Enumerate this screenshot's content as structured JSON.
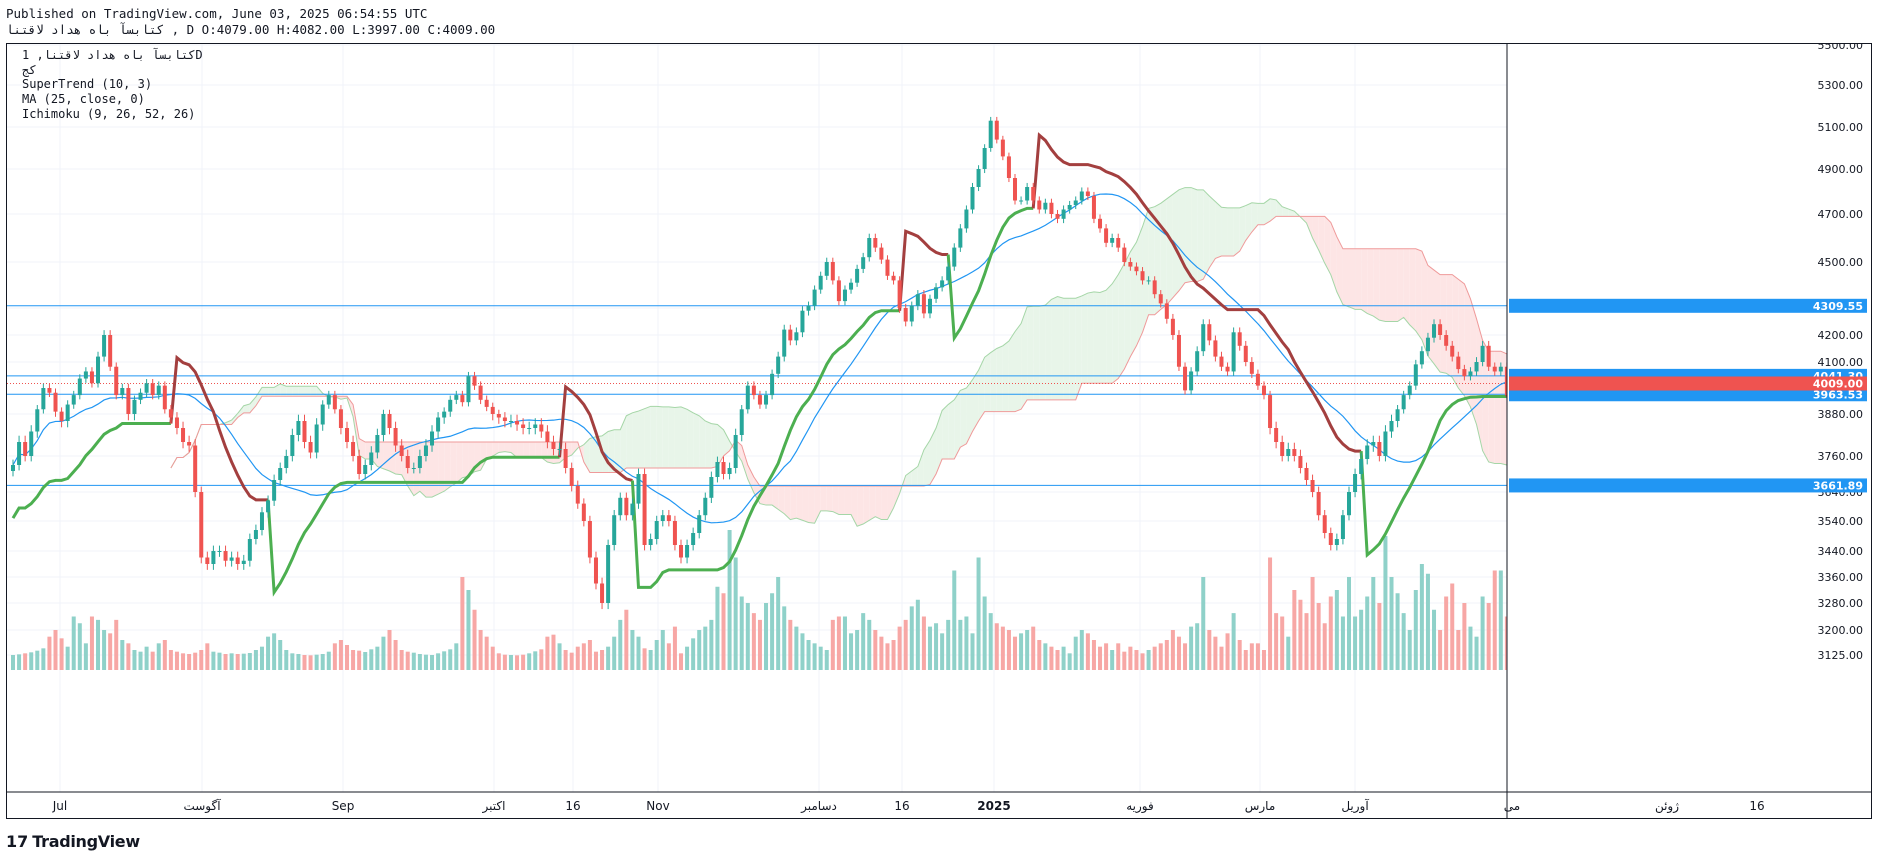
{
  "header": {
    "published": "Published on TradingView.com, June 03, 2025 06:54:55 UTC",
    "ohlc": "كتابسآ باه هداد لاقتنا , D O:4079.00 H:4082.00 L:3997.00 C:4009.00"
  },
  "legend": {
    "symbol": "كتابسآ باه هداد لاقتنا, 1D",
    "exchange": "كج",
    "supertrend": "SuperTrend (10, 3)",
    "ma": "MA (25, close, 0)",
    "ichimoku": "Ichimoku (9, 26, 52, 26)"
  },
  "footer": {
    "logo_mark": "17",
    "logo_text": "TradingView"
  },
  "colors": {
    "up": "#26a69a",
    "down": "#ef5350",
    "supertrend_up": "#4caf50",
    "supertrend_down": "#a33f3f",
    "ma": "#2196f3",
    "cloud_bull": "#e8f5e9",
    "cloud_bear": "#fde5e5",
    "hline": "#2196f3",
    "last_price": "#ef5350"
  },
  "chart_data": {
    "type": "candlestick",
    "y_axis": {
      "range": [
        3080,
        5500
      ],
      "ticks": [
        "5500.00",
        "5300.00",
        "5100.00",
        "4900.00",
        "4700.00",
        "4500.00",
        "4300.00",
        "4200.00",
        "4100.00",
        "3880.00",
        "3760.00",
        "3640.00",
        "3540.00",
        "3440.00",
        "3360.00",
        "3280.00",
        "3200.00",
        "3125.00"
      ]
    },
    "x_axis": {
      "labels": [
        "Jul",
        "آگوست",
        "Sep",
        "اکتبر",
        "16",
        "Nov",
        "دسامبر",
        "16",
        "2025",
        "فوریه",
        "مارس",
        "آوریل",
        "می",
        "ژوئن",
        "16"
      ]
    },
    "horizontal_lines": [
      {
        "value": 4309.55,
        "label": "4309.55"
      },
      {
        "value": 4041.3,
        "label": "4041.30"
      },
      {
        "value": 3963.53,
        "label": "3963.53"
      },
      {
        "value": 3661.89,
        "label": "3661.89"
      }
    ],
    "last_price": {
      "value": 4009.0,
      "label": "4009.00"
    },
    "last_candle": {
      "open": 4079.0,
      "high": 4082.0,
      "low": 3997.0,
      "close": 4009.0
    },
    "closes": [
      3730,
      3800,
      3760,
      3830,
      3900,
      3990,
      3970,
      3890,
      3860,
      3920,
      3960,
      4030,
      4060,
      4010,
      4120,
      4200,
      4080,
      3960,
      3990,
      3880,
      3940,
      3970,
      4010,
      3960,
      4000,
      3900,
      3870,
      3840,
      3800,
      3790,
      3640,
      3420,
      3400,
      3440,
      3440,
      3410,
      3420,
      3400,
      3410,
      3480,
      3510,
      3570,
      3610,
      3680,
      3720,
      3760,
      3820,
      3860,
      3800,
      3770,
      3850,
      3920,
      3960,
      3900,
      3840,
      3800,
      3760,
      3700,
      3730,
      3770,
      3820,
      3880,
      3840,
      3790,
      3760,
      3720,
      3720,
      3760,
      3790,
      3830,
      3870,
      3890,
      3940,
      3960,
      3930,
      4040,
      4000,
      3940,
      3910,
      3880,
      3870,
      3860,
      3860,
      3850,
      3840,
      3840,
      3850,
      3830,
      3800,
      3780,
      3780,
      3720,
      3660,
      3600,
      3540,
      3420,
      3340,
      3280,
      3460,
      3560,
      3620,
      3560,
      3600,
      3700,
      3460,
      3480,
      3540,
      3560,
      3540,
      3460,
      3420,
      3460,
      3500,
      3560,
      3620,
      3690,
      3740,
      3700,
      3720,
      3820,
      3900,
      4000,
      3960,
      3920,
      3960,
      4050,
      4120,
      4220,
      4180,
      4210,
      4290,
      4310,
      4380,
      4440,
      4500,
      4420,
      4330,
      4380,
      4410,
      4470,
      4520,
      4600,
      4560,
      4510,
      4440,
      4420,
      4300,
      4250,
      4310,
      4360,
      4280,
      4340,
      4390,
      4420,
      4480,
      4560,
      4640,
      4720,
      4820,
      4900,
      5000,
      5130,
      5040,
      4960,
      4860,
      4760,
      4760,
      4820,
      4760,
      4720,
      4750,
      4700,
      4680,
      4720,
      4740,
      4760,
      4800,
      4780,
      4680,
      4640,
      4580,
      4600,
      4560,
      4500,
      4480,
      4460,
      4420,
      4420,
      4360,
      4320,
      4260,
      4200,
      4080,
      3980,
      4060,
      4140,
      4240,
      4180,
      4120,
      4080,
      4060,
      4210,
      4160,
      4100,
      4050,
      4000,
      3960,
      3840,
      3800,
      3760,
      3780,
      3760,
      3720,
      3680,
      3640,
      3560,
      3500,
      3460,
      3480,
      3560,
      3640,
      3700,
      3750,
      3790,
      3800,
      3760,
      3830,
      3860,
      3900,
      3960,
      4000,
      4090,
      4140,
      4190,
      4240,
      4200,
      4160,
      4120,
      4070,
      4040,
      4060,
      4100,
      4160,
      4080,
      4060,
      4080,
      3960,
      3940,
      3920,
      3900,
      3960,
      4000,
      4060,
      4040,
      4100,
      4200,
      4300,
      4400,
      4460,
      4420,
      4340,
      4300,
      4160,
      4100,
      4060,
      4000,
      3960,
      3900,
      3840,
      3840,
      3860,
      3820,
      3860,
      3880,
      3960,
      4009
    ],
    "volumes": [
      3125,
      3127,
      3130,
      3133,
      3138,
      3145,
      3180,
      3200,
      3175,
      3150,
      3240,
      3220,
      3160,
      3240,
      3230,
      3200,
      3190,
      3230,
      3170,
      3160,
      3140,
      3135,
      3150,
      3135,
      3160,
      3170,
      3140,
      3135,
      3130,
      3128,
      3132,
      3140,
      3160,
      3135,
      3132,
      3128,
      3130,
      3128,
      3129,
      3131,
      3140,
      3150,
      3180,
      3190,
      3170,
      3140,
      3130,
      3128,
      3125,
      3124,
      3126,
      3128,
      3135,
      3160,
      3170,
      3155,
      3140,
      3138,
      3134,
      3142,
      3150,
      3180,
      3200,
      3170,
      3140,
      3135,
      3132,
      3128,
      3126,
      3125,
      3130,
      3136,
      3142,
      3160,
      3360,
      3320,
      3260,
      3200,
      3180,
      3150,
      3130,
      3126,
      3125,
      3124,
      3126,
      3130,
      3136,
      3142,
      3180,
      3186,
      3160,
      3140,
      3132,
      3150,
      3160,
      3170,
      3135,
      3140,
      3150,
      3180,
      3230,
      3260,
      3200,
      3180,
      3145,
      3140,
      3170,
      3200,
      3160,
      3210,
      3130,
      3150,
      3175,
      3200,
      3210,
      3230,
      3330,
      3310,
      3510,
      3420,
      3300,
      3280,
      3250,
      3230,
      3280,
      3310,
      3360,
      3270,
      3230,
      3210,
      3190,
      3170,
      3160,
      3150,
      3140,
      3230,
      3240,
      3240,
      3190,
      3200,
      3250,
      3230,
      3200,
      3180,
      3160,
      3170,
      3210,
      3230,
      3270,
      3290,
      3240,
      3210,
      3220,
      3190,
      3230,
      3380,
      3230,
      3240,
      3190,
      3420,
      3300,
      3250,
      3220,
      3210,
      3200,
      3180,
      3190,
      3200,
      3210,
      3170,
      3160,
      3150,
      3140,
      3150,
      3130,
      3180,
      3200,
      3190,
      3170,
      3150,
      3160,
      3140,
      3160,
      3135,
      3150,
      3140,
      3130,
      3140,
      3150,
      3160,
      3170,
      3200,
      3180,
      3160,
      3210,
      3220,
      3360,
      3200,
      3180,
      3150,
      3190,
      3250,
      3170,
      3140,
      3160,
      3160,
      3140,
      3420,
      3250,
      3240,
      3180,
      3320,
      3290,
      3250,
      3360,
      3280,
      3220,
      3300,
      3320,
      3240,
      3360,
      3240,
      3260,
      3300,
      3360,
      3280,
      3490,
      3360,
      3310,
      3250,
      3200,
      3320,
      3400,
      3370,
      3260,
      3200,
      3300,
      3340,
      3200,
      3280,
      3210,
      3180,
      3300,
      3280,
      3380,
      3380,
      3240,
      3360,
      3250,
      3520,
      3360,
      3290,
      3210,
      3260,
      3220,
      3310,
      3240,
      3290,
      3270,
      3180,
      3280,
      3300,
      3200,
      3260,
      3210,
      3560,
      3430,
      3180,
      3180,
      3170,
      3170,
      3160,
      3180,
      3230,
      3380,
      3260
    ]
  }
}
